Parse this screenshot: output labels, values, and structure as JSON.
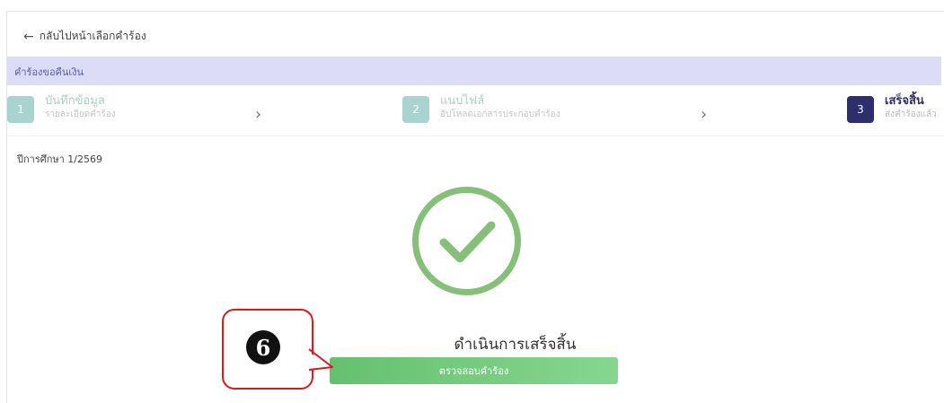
{
  "back_link": {
    "label": "กลับไปหน้าเลือกคำร้อง"
  },
  "section": {
    "title": "คำร้องขอคืนเงิน"
  },
  "steps": [
    {
      "number": "1",
      "title": "บันทึกข้อมูล",
      "subtitle": "รายละเอียดคำร้อง",
      "state": "done"
    },
    {
      "number": "2",
      "title": "แนบไฟล์",
      "subtitle": "อัปโหลดเอกสารประกอบคำร้อง",
      "state": "done"
    },
    {
      "number": "3",
      "title": "เสร็จสิ้น",
      "subtitle": "ส่งคำร้องแล้ว",
      "state": "active"
    }
  ],
  "academic_year": "ปีการศึกษา 1/2569",
  "completion": {
    "message": "ดำเนินการเสร็จสิ้น",
    "button_label": "ตรวจสอบคำร้อง"
  },
  "annotation": {
    "badge": "6"
  },
  "icons": {
    "back": "arrow-left-icon",
    "chevron": "chevron-right-icon",
    "success": "check-circle-icon"
  },
  "colors": {
    "success": "#86c078",
    "primary": "#2c2f6b",
    "accent_bar": "#dcdcf7",
    "callout": "#d61c1c"
  }
}
